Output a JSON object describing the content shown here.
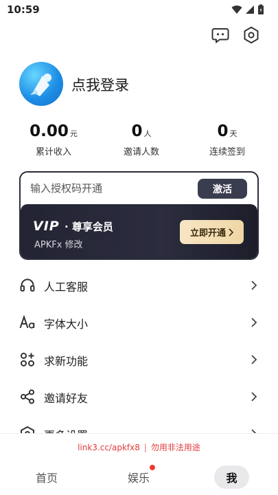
{
  "status_bar": {
    "time": "10:59"
  },
  "header": {
    "message_icon": "message-icon",
    "settings_icon": "settings-icon"
  },
  "profile": {
    "login_text": "点我登录"
  },
  "stats": [
    {
      "value": "0.00",
      "unit": "元",
      "label": "累计收入"
    },
    {
      "value": "0",
      "unit": "人",
      "label": "邀请人数"
    },
    {
      "value": "0",
      "unit": "天",
      "label": "连续签到"
    }
  ],
  "activation": {
    "placeholder": "输入授权码开通",
    "button": "激活"
  },
  "vip": {
    "logo": "VIP",
    "title": "· 尊享会员",
    "subtitle": "APKFx 修改",
    "open_button": "立即开通"
  },
  "menu": [
    {
      "label": "人工客服",
      "icon": "headset-icon"
    },
    {
      "label": "字体大小",
      "icon": "font-size-icon"
    },
    {
      "label": "求新功能",
      "icon": "apps-add-icon"
    },
    {
      "label": "邀请好友",
      "icon": "share-icon"
    },
    {
      "label": "更多设置",
      "icon": "more-settings-icon"
    }
  ],
  "notice": {
    "link": "link3.cc/apkfx8",
    "separator": "|",
    "warning": "勿用非法用途"
  },
  "tabs": [
    {
      "label": "首页"
    },
    {
      "label": "娱乐"
    },
    {
      "label": "我"
    }
  ],
  "colors": {
    "accent_dark": "#2b2c3d",
    "gold": "#efd6a6",
    "warning_red": "#e23a3a"
  }
}
